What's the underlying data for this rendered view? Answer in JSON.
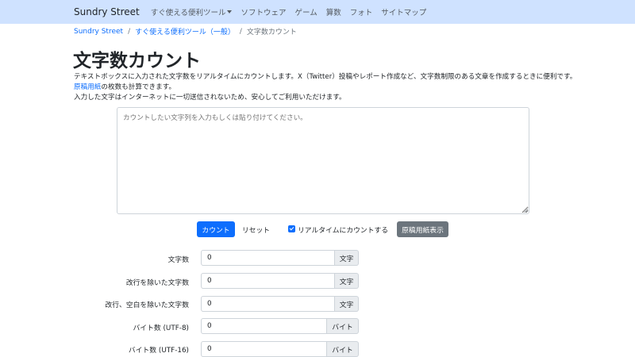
{
  "navbar": {
    "brand": "Sundry Street",
    "items": [
      {
        "label": "すぐ使える便利ツール",
        "dropdown": true
      },
      {
        "label": "ソフトウェア"
      },
      {
        "label": "ゲーム"
      },
      {
        "label": "算数"
      },
      {
        "label": "フォト"
      },
      {
        "label": "サイトマップ"
      }
    ]
  },
  "breadcrumb": {
    "home": "Sundry Street",
    "category": "すぐ使える便利ツール（一般）",
    "current": "文字数カウント",
    "separator": "/"
  },
  "page": {
    "title": "文字数カウント",
    "desc_line1": "テキストボックスに入力された文字数をリアルタイムにカウントします。X（Twitter）投稿やレポート作成など、文字数制限のある文章を作成するときに便利です。",
    "desc_line2_link": "原稿用紙",
    "desc_line2_rest": "の枚数も計算できます。",
    "desc_line3": "入力した文字はインターネットに一切送信されないため、安心してご利用いただけます。"
  },
  "textarea": {
    "placeholder": "カウントしたい文字列を入力もしくは貼り付けてください。",
    "value": ""
  },
  "controls": {
    "count_button": "カウント",
    "reset_button": "リセット",
    "realtime_label": "リアルタイムにカウントする",
    "realtime_checked": true,
    "manuscript_button": "原稿用紙表示"
  },
  "results": [
    {
      "label": "文字数",
      "value": "0",
      "unit": "文字"
    },
    {
      "label": "改行を除いた文字数",
      "value": "0",
      "unit": "文字"
    },
    {
      "label": "改行、空白を除いた文字数",
      "value": "0",
      "unit": "文字"
    },
    {
      "label": "バイト数 (UTF-8)",
      "value": "0",
      "unit": "バイト"
    },
    {
      "label": "バイト数 (UTF-16)",
      "value": "0",
      "unit": "バイト"
    }
  ],
  "colors": {
    "navbar_bg": "#cfe2ff",
    "primary": "#0d6efd",
    "secondary": "#6c757d",
    "input_group_bg": "#e9ecef"
  }
}
